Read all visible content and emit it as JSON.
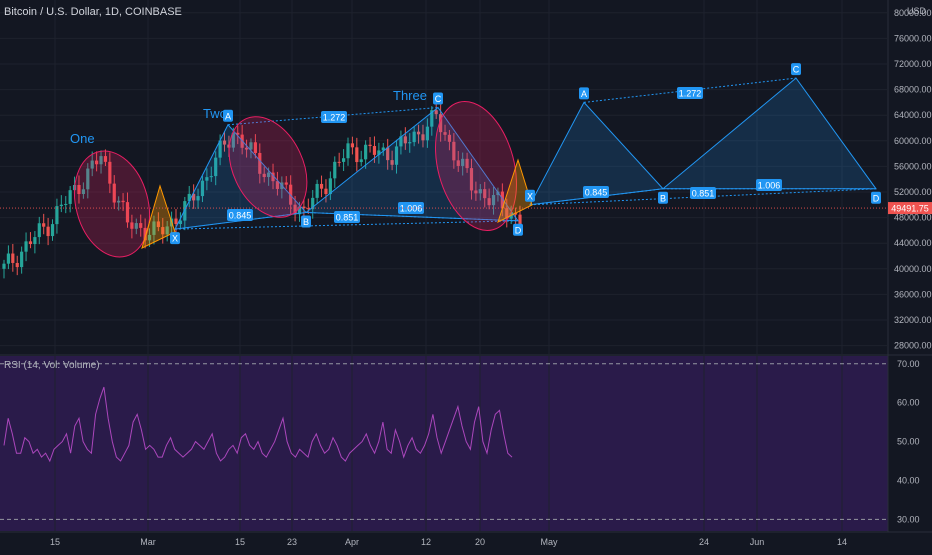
{
  "header": {
    "symbol_title": "Bitcoin / U.S. Dollar, 1D, COINBASE",
    "currency": "USD"
  },
  "rsi": {
    "title": "RSI (14, Vol: Volume)",
    "levels": [
      70,
      30
    ],
    "ticks": [
      "70.00",
      "60.00",
      "50.00",
      "40.00",
      "30.00"
    ],
    "values": [
      49,
      56,
      52,
      47,
      47,
      51,
      50,
      47,
      48,
      46,
      47,
      45,
      48,
      49,
      50,
      52,
      47,
      54,
      56,
      50,
      48,
      47,
      57,
      61,
      64,
      56,
      50,
      46,
      45,
      47,
      49,
      55,
      57,
      53,
      48,
      49,
      48,
      46,
      46,
      49,
      51,
      48,
      47,
      46,
      47,
      48,
      50,
      49,
      48,
      50,
      52,
      47,
      45,
      46,
      48,
      49,
      47,
      51,
      52,
      49,
      48,
      50,
      47,
      46,
      48,
      50,
      53,
      56,
      50,
      47,
      46,
      48,
      47,
      46,
      50,
      52,
      49,
      47,
      48,
      51,
      49,
      46,
      45,
      47,
      48,
      49,
      50,
      52,
      49,
      47,
      50,
      55,
      48,
      47,
      53,
      50,
      46,
      49,
      51,
      48,
      47,
      49,
      52,
      57,
      51,
      47,
      50,
      53,
      56,
      59,
      54,
      50,
      48,
      55,
      59,
      50,
      47,
      53,
      57,
      58,
      52,
      47,
      46
    ]
  },
  "price_axis": {
    "ticks": [
      "80000.00",
      "76000.00",
      "72000.00",
      "68000.00",
      "64000.00",
      "60000.00",
      "56000.00",
      "52000.00",
      "48000.00",
      "44000.00",
      "40000.00",
      "36000.00",
      "32000.00",
      "28000.00"
    ],
    "last_price": "49491.75"
  },
  "time_axis": {
    "ticks": [
      "15",
      "Mar",
      "15",
      "23",
      "Apr",
      "12",
      "20",
      "May",
      "24",
      "Jun",
      "14"
    ]
  },
  "chart_data": {
    "type": "candlestick",
    "title": "Bitcoin / U.S. Dollar, 1D, COINBASE",
    "ylim": [
      27000,
      82000
    ],
    "colors": {
      "up": "#26a69a",
      "down": "#ef5350",
      "pattern": "#2196f3",
      "highlight": "#e91e63",
      "triangle": "#ff9800"
    },
    "candles_count": 118,
    "harmonic_labels": [
      "One",
      "Two",
      "Three"
    ],
    "pattern_points": [
      {
        "label": "X",
        "price": 46200
      },
      {
        "label": "A",
        "price": 62500
      },
      {
        "label": "B",
        "price": 48800
      },
      {
        "label": "C",
        "price": 65200
      },
      {
        "label": "D",
        "price": 47500
      },
      {
        "label": "X",
        "price": 50000
      },
      {
        "label": "A",
        "price": 66000
      },
      {
        "label": "B",
        "price": 52500
      },
      {
        "label": "C",
        "price": 69800
      },
      {
        "label": "D",
        "price": 52500
      }
    ],
    "ratio_labels": [
      "1.272",
      "0.845",
      "0.851",
      "1.006",
      "1.272",
      "0.845",
      "0.851",
      "1.006"
    ]
  }
}
